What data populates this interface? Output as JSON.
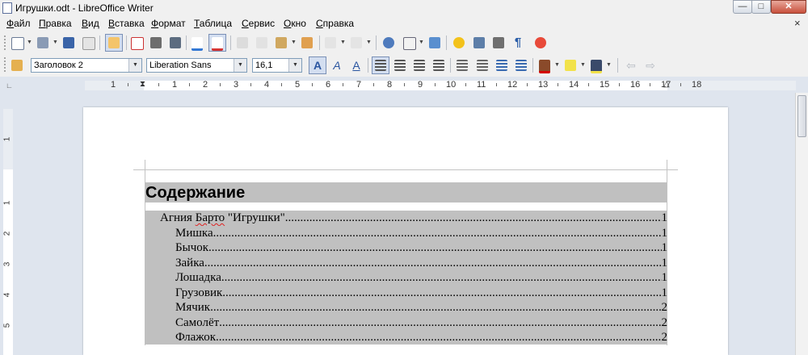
{
  "window": {
    "title": "Игрушки.odt - LibreOffice Writer",
    "minimize": "—",
    "maximize": "□",
    "close": "✕",
    "doc_close": "×"
  },
  "menu": [
    {
      "label": "Файл",
      "accel": "Ф",
      "rest": "айл"
    },
    {
      "label": "Правка",
      "accel": "П",
      "rest": "равка"
    },
    {
      "label": "Вид",
      "accel": "В",
      "rest": "ид"
    },
    {
      "label": "Вставка",
      "accel": "В",
      "rest": "ставка"
    },
    {
      "label": "Формат",
      "accel": "Ф",
      "rest": "ормат"
    },
    {
      "label": "Таблица",
      "accel": "Т",
      "rest": "аблица"
    },
    {
      "label": "Сервис",
      "accel": "С",
      "rest": "ервис"
    },
    {
      "label": "Окно",
      "accel": "О",
      "rest": "кно"
    },
    {
      "label": "Справка",
      "accel": "С",
      "rest": "правка"
    }
  ],
  "formatting": {
    "paragraph_style": "Заголовок 2",
    "font_name": "Liberation Sans",
    "font_size": "16,1"
  },
  "toolbar_icons": {
    "standard": [
      "new-document-icon",
      "open-icon",
      "save-icon",
      "email-icon",
      "edit-mode-icon",
      "export-pdf-icon",
      "print-icon",
      "print-preview-icon",
      "spellcheck-icon",
      "autospellcheck-icon",
      "cut-icon",
      "copy-icon",
      "paste-icon",
      "clone-formatting-icon",
      "undo-icon",
      "redo-icon",
      "navigator-icon",
      "table-icon",
      "draw-functions-icon",
      "gallery-icon",
      "datasources-icon",
      "nonprinting-chars-icon",
      "help-icon"
    ],
    "formatting": [
      "styles-icon",
      "bold-icon",
      "italic-icon",
      "underline-icon",
      "align-left-icon",
      "align-center-icon",
      "align-right-icon",
      "justify-icon",
      "numbering-icon",
      "bullets-icon",
      "decrease-indent-icon",
      "increase-indent-icon",
      "font-color-icon",
      "highlight-icon",
      "background-color-icon"
    ]
  },
  "ruler": {
    "numbers": [
      "1",
      "1",
      "2",
      "3",
      "4",
      "5",
      "6",
      "7",
      "8",
      "9",
      "10",
      "11",
      "12",
      "13",
      "14",
      "15",
      "16",
      "17",
      "18"
    ],
    "vertical_numbers": [
      "1",
      "1",
      "2",
      "3",
      "4",
      "5"
    ]
  },
  "document": {
    "toc_title": "Содержание",
    "entries": [
      {
        "text": "Агния Барто \"Игрушки\"",
        "page": "1",
        "level": 1
      },
      {
        "text": "Мишка",
        "page": "1",
        "level": 2
      },
      {
        "text": "Бычок",
        "page": "1",
        "level": 2
      },
      {
        "text": "Зайка",
        "page": "1",
        "level": 2
      },
      {
        "text": "Лошадка",
        "page": "1",
        "level": 2
      },
      {
        "text": "Грузовик",
        "page": "1",
        "level": 2
      },
      {
        "text": "Мячик",
        "page": "2",
        "level": 2
      },
      {
        "text": "Самолёт",
        "page": "2",
        "level": 2
      },
      {
        "text": "Флажок",
        "page": "2",
        "level": 2
      }
    ]
  },
  "colors": {
    "toc_shading": "#c0c0c0",
    "window_bg": "#dfe5ee",
    "close_button": "#c8503c"
  }
}
